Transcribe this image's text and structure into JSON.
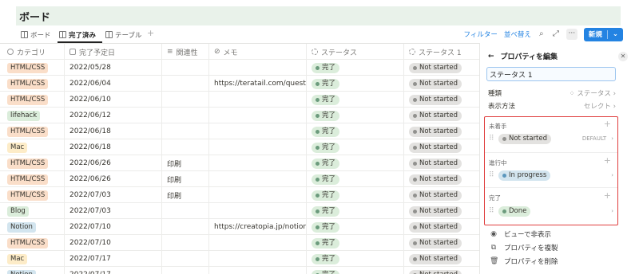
{
  "page": {
    "title": "ボード"
  },
  "views": {
    "tabs": [
      {
        "label": "ボード",
        "active": false
      },
      {
        "label": "完了済み",
        "active": true
      },
      {
        "label": "テーブル",
        "active": false
      }
    ],
    "add_symbol": "+"
  },
  "toolbar": {
    "filter": "フィルター",
    "sort": "並べ替え",
    "more": "···",
    "new": "新規"
  },
  "table": {
    "headers": [
      "カテゴリ",
      "完了予定日",
      "関連性",
      "メモ",
      "ステータス",
      "ステータス 1"
    ],
    "rows": [
      {
        "category": "HTML/CSS",
        "date": "2022/05/28",
        "relation": "",
        "memo": "",
        "status": "完了",
        "status1": "Not started"
      },
      {
        "category": "HTML/CSS",
        "date": "2022/06/04",
        "relation": "",
        "memo": "https://teratail.com/questions/",
        "status": "完了",
        "status1": "Not started"
      },
      {
        "category": "HTML/CSS",
        "date": "2022/06/10",
        "relation": "",
        "memo": "",
        "status": "完了",
        "status1": "Not started"
      },
      {
        "category": "lifehack",
        "date": "2022/06/12",
        "relation": "",
        "memo": "",
        "status": "完了",
        "status1": "Not started"
      },
      {
        "category": "HTML/CSS",
        "date": "2022/06/18",
        "relation": "",
        "memo": "",
        "status": "完了",
        "status1": "Not started"
      },
      {
        "category": "Mac",
        "date": "2022/06/18",
        "relation": "",
        "memo": "",
        "status": "完了",
        "status1": "Not started"
      },
      {
        "category": "HTML/CSS",
        "date": "2022/06/26",
        "relation": "印刷",
        "memo": "",
        "status": "完了",
        "status1": "Not started"
      },
      {
        "category": "HTML/CSS",
        "date": "2022/06/26",
        "relation": "印刷",
        "memo": "",
        "status": "完了",
        "status1": "Not started"
      },
      {
        "category": "HTML/CSS",
        "date": "2022/07/03",
        "relation": "印刷",
        "memo": "",
        "status": "完了",
        "status1": "Not started"
      },
      {
        "category": "Blog",
        "date": "2022/07/03",
        "relation": "",
        "memo": "",
        "status": "完了",
        "status1": "Not started"
      },
      {
        "category": "Notion",
        "date": "2022/07/10",
        "relation": "",
        "memo": "https://creatopia.jp/notion-spr",
        "status": "完了",
        "status1": "Not started"
      },
      {
        "category": "HTML/CSS",
        "date": "2022/07/10",
        "relation": "",
        "memo": "",
        "status": "完了",
        "status1": "Not started"
      },
      {
        "category": "Mac",
        "date": "2022/07/17",
        "relation": "",
        "memo": "",
        "status": "完了",
        "status1": "Not started"
      },
      {
        "category": "Notion",
        "date": "2022/07/17",
        "relation": "",
        "memo": "",
        "status": "完了",
        "status1": "Not started"
      }
    ]
  },
  "panel": {
    "title": "プロパティを編集",
    "name_value": "ステータス 1",
    "type_label": "種類",
    "type_value": "ステータス",
    "display_label": "表示方法",
    "display_value": "セレクト",
    "groups": [
      {
        "label": "未着手",
        "option": "Not started",
        "badge": "DEFAULT"
      },
      {
        "label": "進行中",
        "option": "In progress",
        "badge": ""
      },
      {
        "label": "完了",
        "option": "Done",
        "badge": ""
      }
    ],
    "actions": [
      "ビューで非表示",
      "プロパティを複製",
      "プロパティを削除"
    ]
  },
  "colors": {
    "HTML/CSS": "#fadec9",
    "lifehack": "#dbeddb",
    "Mac": "#fdecc8",
    "Blog": "#dbeddb",
    "Notion": "#d3e5ef",
    "status_green": "#dbeddb",
    "status_gray": "#e3e2e0",
    "status_blue": "#d3e5ef",
    "accent": "#2383e2",
    "highlight": "#e03e3e"
  }
}
